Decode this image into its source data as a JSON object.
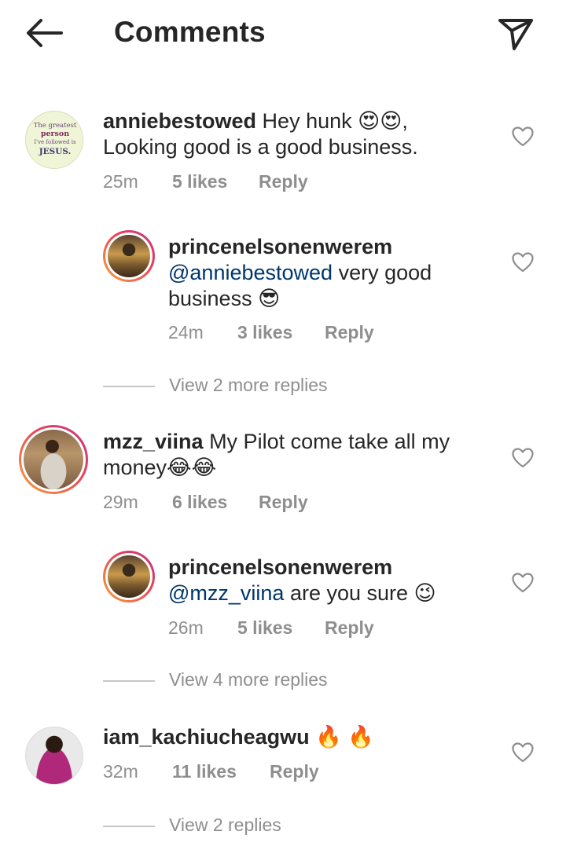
{
  "header": {
    "title": "Comments"
  },
  "comments": [
    {
      "username": "anniebestowed",
      "text": " Hey hunk 😍😍,",
      "text2": "Looking good is a good business.",
      "time": "25m",
      "likes": "5 likes",
      "reply": "Reply",
      "avatar_text": [
        "The greatest",
        "person",
        "I've followed is",
        "JESUS."
      ]
    },
    {
      "username": "princenelsonenwerem",
      "mention": "@anniebestowed",
      "text": " very good",
      "text2": "business 😎",
      "time": "24m",
      "likes": "3 likes",
      "reply": "Reply",
      "view_more": "View 2 more replies"
    },
    {
      "username": "mzz_viina",
      "text": " My Pilot come take all my",
      "text2": "money😂😂",
      "time": "29m",
      "likes": "6 likes",
      "reply": "Reply"
    },
    {
      "username": "princenelsonenwerem",
      "mention": "@mzz_viina",
      "text": " are you sure 😉",
      "time": "26m",
      "likes": "5 likes",
      "reply": "Reply",
      "view_more": "View 4 more replies"
    },
    {
      "username": "iam_kachiucheagwu",
      "text": " 🔥 🔥",
      "time": "32m",
      "likes": "11 likes",
      "reply": "Reply",
      "view_more": "View 2 replies"
    }
  ],
  "colors": {
    "text": "#262626",
    "secondary": "#8e8e8e",
    "mention": "#00376b",
    "story_ring_start": "#f9a13a",
    "story_ring_end": "#c13584"
  },
  "icons": {
    "back": "arrow-left-icon",
    "send": "paper-plane-icon",
    "like": "heart-outline-icon"
  }
}
